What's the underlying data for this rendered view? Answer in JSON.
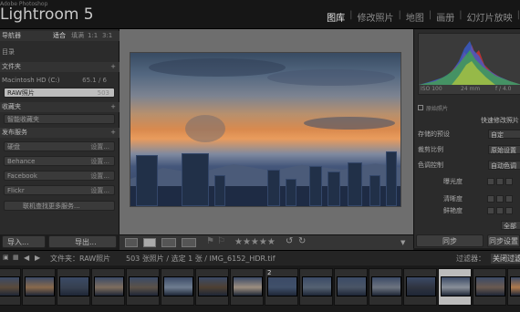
{
  "app": {
    "brand_sub": "Adobe Photoshop",
    "brand": "Lightroom 5"
  },
  "modules": [
    "图库",
    "修改照片",
    "地图",
    "画册",
    "幻灯片放映"
  ],
  "active_module": "图库",
  "left_panel": {
    "navigator": {
      "title": "导航器",
      "opts": [
        "适合",
        "填满",
        "1:1",
        "3:1"
      ]
    },
    "catalog_title": "目录",
    "folders_title": "文件夹",
    "drive_row": {
      "label": "Macintosh HD (C:)",
      "value": "65.1 / 6"
    },
    "raw_folder": {
      "label": "RAW照片",
      "count": "503"
    },
    "collections_title": "收藏夹",
    "smart_collection": "智能收藏夹",
    "publish_title": "发布服务",
    "services": [
      {
        "label": "硬盘",
        "action": "设置..."
      },
      {
        "label": "Behance",
        "action": "设置..."
      },
      {
        "label": "Facebook",
        "action": "设置..."
      },
      {
        "label": "Flickr",
        "action": "设置..."
      }
    ],
    "find_more": "联机查找更多服务...",
    "import_label": "导入...",
    "export_label": "导出..."
  },
  "toolbar": {
    "stars": "★★★★★"
  },
  "right_panel": {
    "histogram": {
      "iso": "ISO 100",
      "focal": "24 mm",
      "aperture": "f / 4.0",
      "original": "原始照片"
    },
    "quick_develop": "快速修改照片",
    "preset_label": "存储的预设",
    "preset_value": "自定",
    "crop_label": "裁剪比例",
    "crop_value": "原始设置",
    "tone_label": "色调控制",
    "tone_value": "自动色调",
    "exposure_label": "曝光度",
    "clarity_label": "清晰度",
    "vibrance_label": "鲜艳度",
    "reset_label": "全部",
    "sync_label": "同步",
    "sync2_label": "同步设置"
  },
  "filmstrip_header": {
    "folder": "文件夹：RAW照片",
    "count": "503 张照片 / 选定 1 张 / IMG_6152_HDR.tif",
    "filter_label": "过滤器：",
    "filter_value": "关闭过滤"
  },
  "filmstrip_thumbs": [
    {
      "color": "#5a4a3a",
      "badge": ""
    },
    {
      "color": "#8a6a4c",
      "badge": ""
    },
    {
      "color": "#364050",
      "badge": ""
    },
    {
      "color": "#7e6e5e",
      "badge": ""
    },
    {
      "color": "#5c5248",
      "badge": ""
    },
    {
      "color": "#6f7d90",
      "badge": ""
    },
    {
      "color": "#4e4032",
      "badge": ""
    },
    {
      "color": "#9d8f80",
      "badge": ""
    },
    {
      "color": "#40506a",
      "badge": "2"
    },
    {
      "color": "#556272",
      "badge": ""
    },
    {
      "color": "#4a5566",
      "badge": ""
    },
    {
      "color": "#6d7480",
      "badge": ""
    },
    {
      "color": "#2f3440",
      "badge": ""
    },
    {
      "color": "#8a9099",
      "badge": ""
    },
    {
      "color": "#6a5a50",
      "badge": ""
    },
    {
      "color": "#b07a4c",
      "badge": ""
    }
  ],
  "colors": {
    "accent": "#e8e8e8",
    "panel": "#2b2b2b",
    "selected": "#bcbcbc"
  }
}
